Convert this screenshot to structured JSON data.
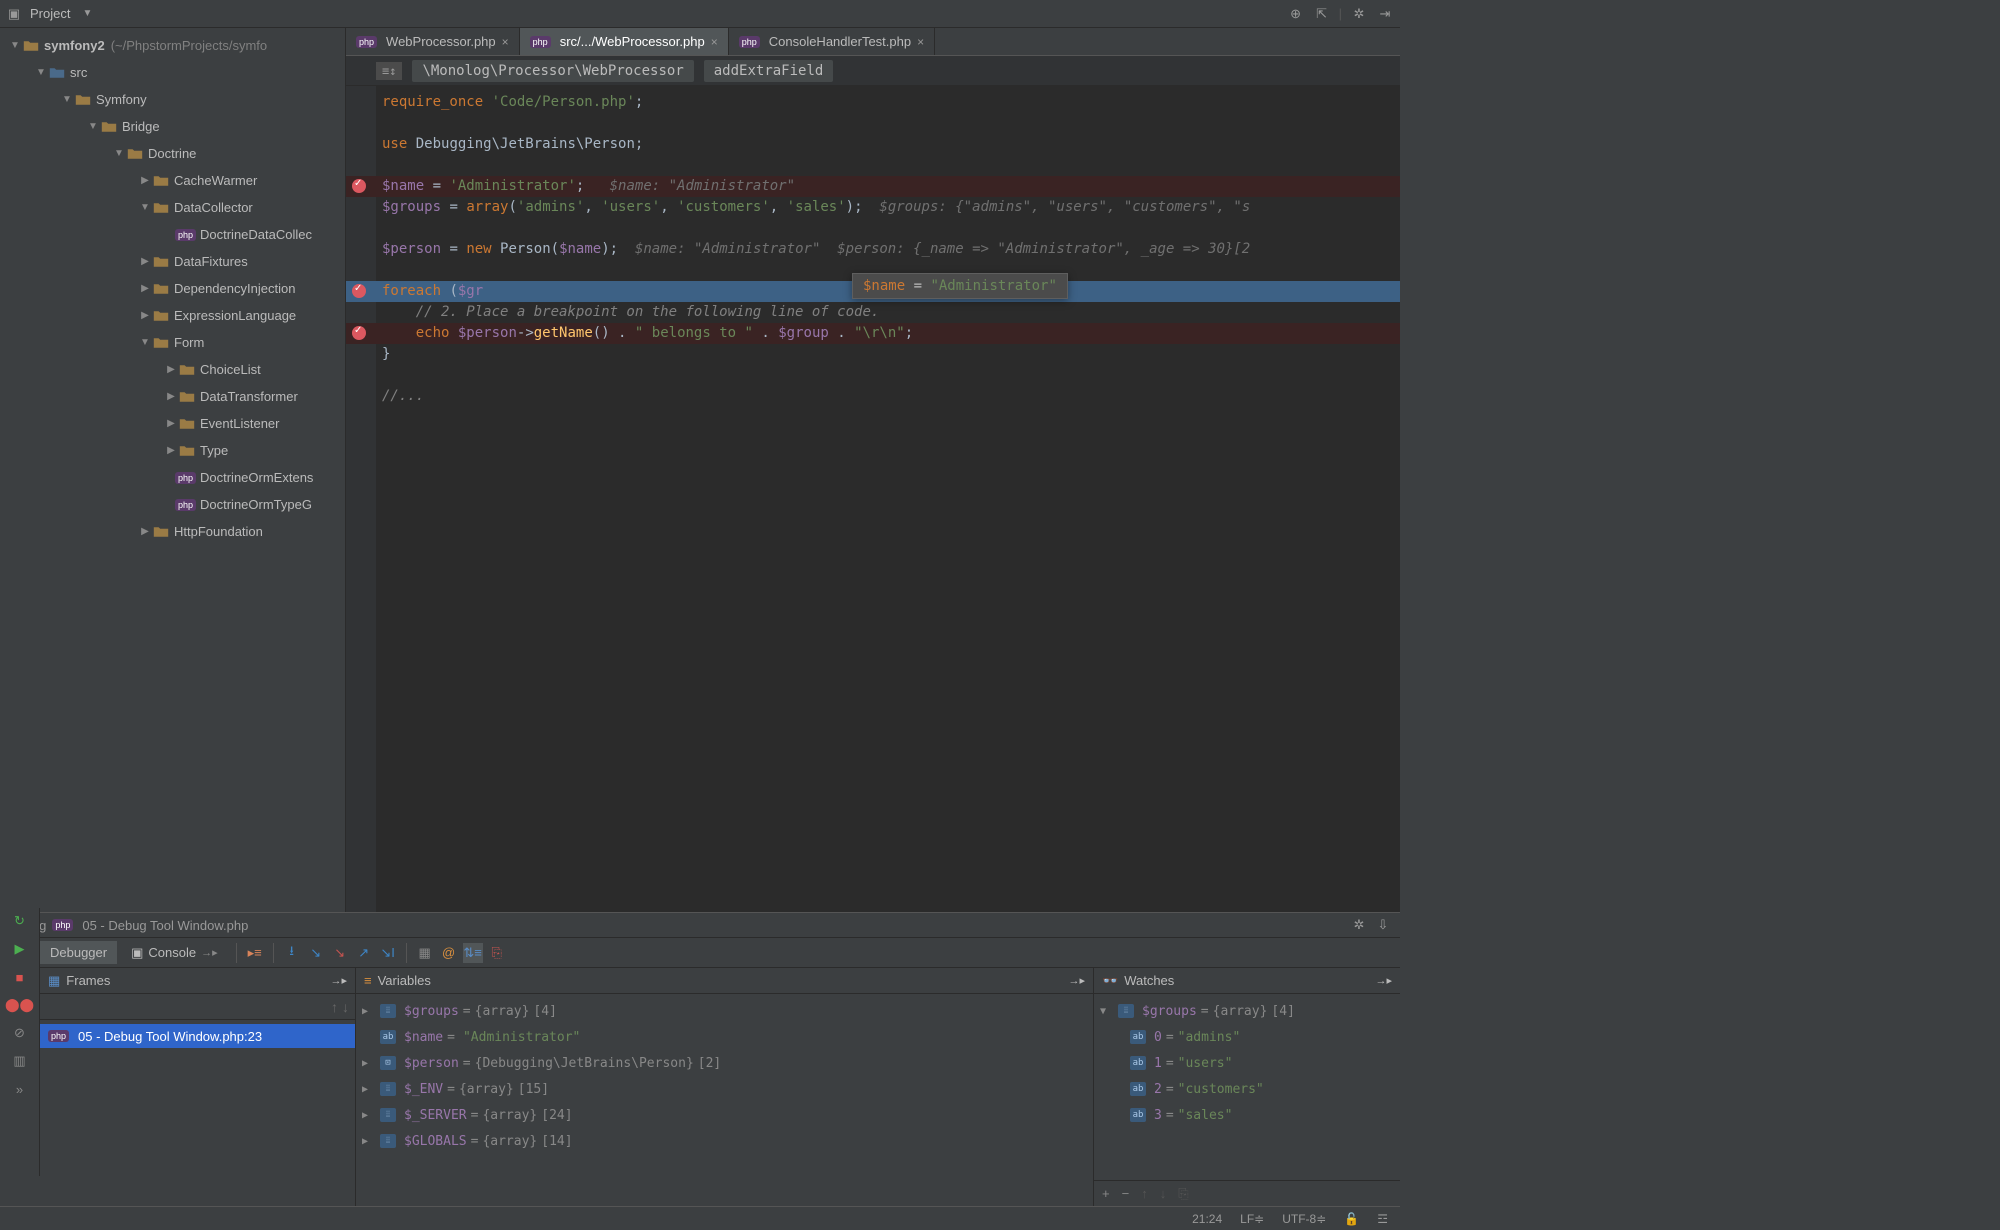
{
  "projectToolbar": {
    "label": "Project"
  },
  "projectTree": {
    "root": {
      "name": "symfony2",
      "path": "(~/PhpstormProjects/symfo"
    },
    "items": [
      {
        "depth": 1,
        "arrow": "▼",
        "icon": "folder-src",
        "label": "src"
      },
      {
        "depth": 2,
        "arrow": "▼",
        "icon": "folder",
        "label": "Symfony"
      },
      {
        "depth": 3,
        "arrow": "▼",
        "icon": "folder",
        "label": "Bridge"
      },
      {
        "depth": 4,
        "arrow": "▼",
        "icon": "folder",
        "label": "Doctrine"
      },
      {
        "depth": 5,
        "arrow": "▶",
        "icon": "folder",
        "label": "CacheWarmer"
      },
      {
        "depth": 5,
        "arrow": "▼",
        "icon": "folder",
        "label": "DataCollector"
      },
      {
        "depth": 6,
        "arrow": "",
        "icon": "php",
        "label": "DoctrineDataCollec"
      },
      {
        "depth": 5,
        "arrow": "▶",
        "icon": "folder",
        "label": "DataFixtures"
      },
      {
        "depth": 5,
        "arrow": "▶",
        "icon": "folder",
        "label": "DependencyInjection"
      },
      {
        "depth": 5,
        "arrow": "▶",
        "icon": "folder",
        "label": "ExpressionLanguage"
      },
      {
        "depth": 5,
        "arrow": "▼",
        "icon": "folder",
        "label": "Form"
      },
      {
        "depth": 6,
        "arrow": "▶",
        "icon": "folder",
        "label": "ChoiceList"
      },
      {
        "depth": 6,
        "arrow": "▶",
        "icon": "folder",
        "label": "DataTransformer"
      },
      {
        "depth": 6,
        "arrow": "▶",
        "icon": "folder",
        "label": "EventListener"
      },
      {
        "depth": 6,
        "arrow": "▶",
        "icon": "folder",
        "label": "Type"
      },
      {
        "depth": 6,
        "arrow": "",
        "icon": "php",
        "label": "DoctrineOrmExtens"
      },
      {
        "depth": 6,
        "arrow": "",
        "icon": "php",
        "label": "DoctrineOrmTypeG"
      },
      {
        "depth": 5,
        "arrow": "▶",
        "icon": "folder",
        "label": "HttpFoundation"
      }
    ]
  },
  "editorTabs": [
    {
      "label": "WebProcessor.php",
      "active": false
    },
    {
      "label": "src/.../WebProcessor.php",
      "active": true
    },
    {
      "label": "ConsoleHandlerTest.php",
      "active": false
    }
  ],
  "breadcrumb": {
    "namespace": "\\Monolog\\Processor\\WebProcessor",
    "method": "addExtraField"
  },
  "code": {
    "lines": [
      {
        "html": "<span class='kw'>require_once</span> <span class='str'>'Code/Person.php'</span>;"
      },
      {
        "html": ""
      },
      {
        "html": "<span class='kw'>use</span> Debugging\\JetBrains\\Person;"
      },
      {
        "html": ""
      },
      {
        "html": "<span class='var'>$name</span> = <span class='str'>'Administrator'</span>;   <span class='hint'>$name: \"Administrator\"</span>",
        "bp": true
      },
      {
        "html": "<span class='var'>$groups</span> = <span class='kw'>array</span>(<span class='str'>'admins'</span>, <span class='str'>'users'</span>, <span class='str'>'customers'</span>, <span class='str'>'sales'</span>);  <span class='hint'>$groups: {\"admins\", \"users\", \"customers\", \"s</span>"
      },
      {
        "html": ""
      },
      {
        "html": "<span class='var'>$person</span> = <span class='kw'>new</span> <span class='cls'>Person</span>(<span class='var'>$name</span>);  <span class='hint'>$name: \"Administrator\"  $person: {_name => \"Administrator\", _age => 30}[2</span>"
      },
      {
        "html": ""
      },
      {
        "html": "<span class='kw'>foreach</span> (<span class='var'>$gr</span>",
        "bp": true,
        "hl": true
      },
      {
        "html": "    <span class='com'>// 2. Place a breakpoint on the following line of code.</span>"
      },
      {
        "html": "    <span class='kw'>echo</span> <span class='var'>$person</span>-><span class='fn'>getName</span>() . <span class='str'>\" belongs to \"</span> . <span class='var'>$group</span> . <span class='str'>\"\\r\\n\"</span>;",
        "bp": true
      },
      {
        "html": "}"
      },
      {
        "html": ""
      },
      {
        "html": "<span class='com'>//...</span>"
      }
    ]
  },
  "tooltip": {
    "var": "$name",
    "val": "\"Administrator\""
  },
  "debugHeader": {
    "label": "Debug",
    "file": "05 - Debug Tool Window.php"
  },
  "debugTabs": {
    "debugger": "Debugger",
    "console": "Console"
  },
  "frames": {
    "title": "Frames",
    "item": "05 - Debug Tool Window.php:23"
  },
  "variables": {
    "title": "Variables",
    "rows": [
      {
        "arrow": "▶",
        "icon": "arr",
        "name": "$groups",
        "eq": " = ",
        "type": "{array} ",
        "val": "[4]"
      },
      {
        "arrow": "",
        "icon": "str",
        "name": "$name",
        "eq": " = ",
        "type": "",
        "val": "\"Administrator\""
      },
      {
        "arrow": "▶",
        "icon": "obj",
        "name": "$person",
        "eq": " = ",
        "type": "{Debugging\\JetBrains\\Person} ",
        "val": "[2]"
      },
      {
        "arrow": "▶",
        "icon": "arr",
        "name": "$_ENV",
        "eq": " = ",
        "type": "{array} ",
        "val": "[15]"
      },
      {
        "arrow": "▶",
        "icon": "arr",
        "name": "$_SERVER",
        "eq": " = ",
        "type": "{array} ",
        "val": "[24]"
      },
      {
        "arrow": "▶",
        "icon": "arr",
        "name": "$GLOBALS",
        "eq": " = ",
        "type": "{array} ",
        "val": "[14]"
      }
    ]
  },
  "watches": {
    "title": "Watches",
    "root": {
      "name": "$groups",
      "eq": " = ",
      "type": "{array} ",
      "val": "[4]"
    },
    "items": [
      {
        "key": "0",
        "val": "\"admins\""
      },
      {
        "key": "1",
        "val": "\"users\""
      },
      {
        "key": "2",
        "val": "\"customers\""
      },
      {
        "key": "3",
        "val": "\"sales\""
      }
    ]
  },
  "statusbar": {
    "pos": "21:24",
    "le": "LF≑",
    "enc": "UTF-8≑",
    "lock": "🔓"
  }
}
